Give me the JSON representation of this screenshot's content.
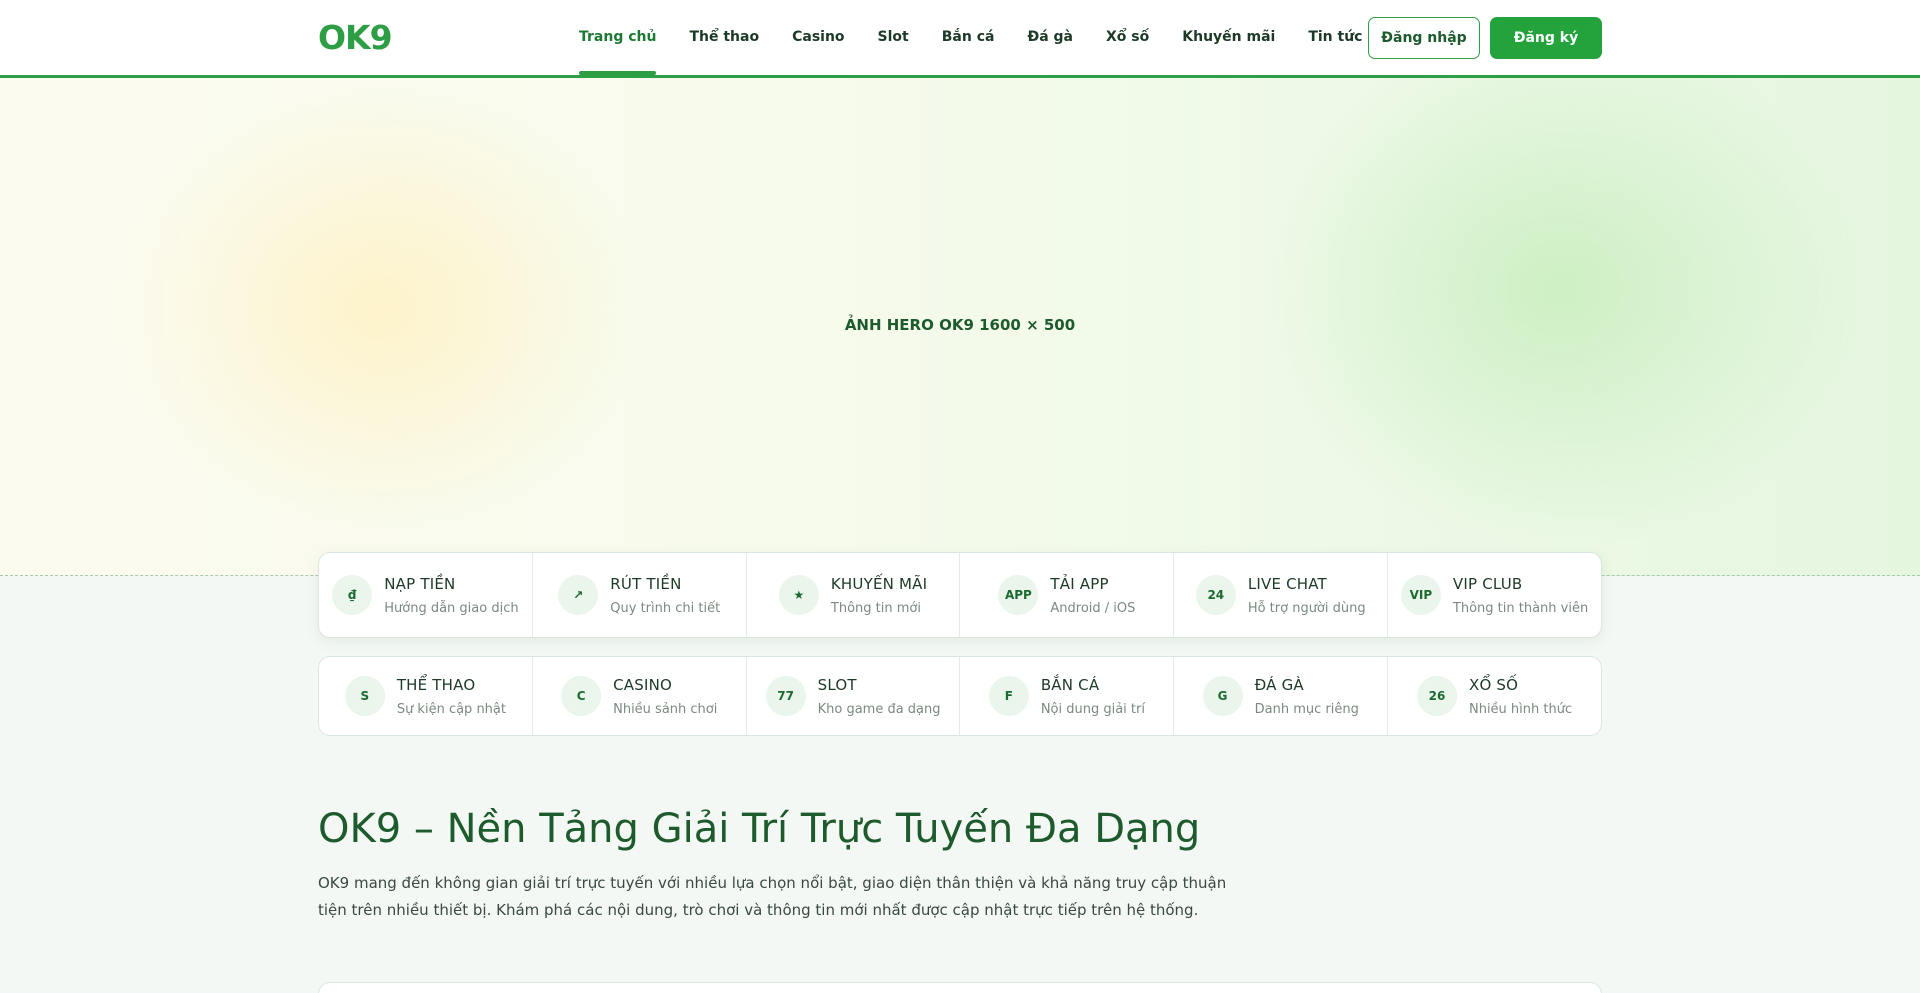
{
  "header": {
    "logo": "OK9",
    "nav": [
      {
        "label": "Trang chủ",
        "active": true
      },
      {
        "label": "Thể thao"
      },
      {
        "label": "Casino"
      },
      {
        "label": "Slot"
      },
      {
        "label": "Bắn cá"
      },
      {
        "label": "Đá gà"
      },
      {
        "label": "Xổ số"
      },
      {
        "label": "Khuyến mãi"
      },
      {
        "label": "Tin tức"
      }
    ],
    "login_label": "Đăng nhập",
    "register_label": "Đăng ký"
  },
  "hero": {
    "placeholder": "ẢNH HERO OK9 1600 × 500"
  },
  "quick_links": [
    {
      "badge": "₫",
      "title": "NẠP TIỀN",
      "sub": "Hướng dẫn giao dịch"
    },
    {
      "badge": "↗",
      "title": "RÚT TIỀN",
      "sub": "Quy trình chi tiết"
    },
    {
      "badge": "★",
      "title": "KHUYẾN MÃI",
      "sub": "Thông tin mới"
    },
    {
      "badge": "APP",
      "title": "TẢI APP",
      "sub": "Android / iOS"
    },
    {
      "badge": "24",
      "title": "LIVE CHAT",
      "sub": "Hỗ trợ người dùng"
    },
    {
      "badge": "VIP",
      "title": "VIP CLUB",
      "sub": "Thông tin thành viên"
    }
  ],
  "categories": [
    {
      "badge": "S",
      "title": "THỂ THAO",
      "sub": "Sự kiện cập nhật"
    },
    {
      "badge": "C",
      "title": "CASINO",
      "sub": "Nhiều sảnh chơi"
    },
    {
      "badge": "77",
      "title": "SLOT",
      "sub": "Kho game đa dạng"
    },
    {
      "badge": "F",
      "title": "BẮN CÁ",
      "sub": "Nội dung giải trí"
    },
    {
      "badge": "G",
      "title": "ĐÁ GÀ",
      "sub": "Danh mục riêng"
    },
    {
      "badge": "26",
      "title": "XỔ SỐ",
      "sub": "Nhiều hình thức"
    }
  ],
  "intro": {
    "title": "OK9 – Nền Tảng Giải Trí Trực Tuyến Đa Dạng",
    "text": "OK9 mang đến không gian giải trí trực tuyến với nhiều lựa chọn nổi bật, giao diện thân thiện và khả năng truy cập thuận tiện trên nhiều thiết bị. Khám phá các nội dung, trò chơi và thông tin mới nhất được cập nhật trực tiếp trên hệ thống."
  },
  "colors": {
    "brand_green": "#2e9e44",
    "dark_green": "#1d5a2c",
    "page_bg": "#f3f8f4"
  }
}
